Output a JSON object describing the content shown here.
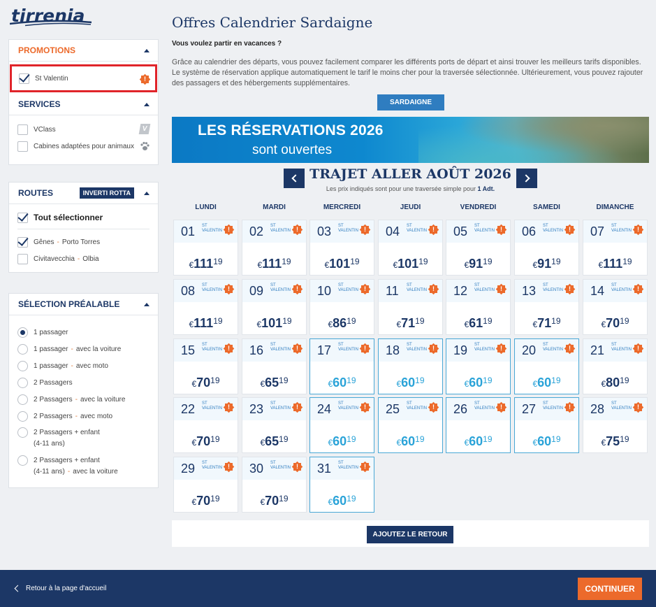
{
  "brand": {
    "logo_text": "tirrenia"
  },
  "sidebar": {
    "promotions": {
      "title": "PROMOTIONS",
      "items": [
        {
          "label": "St Valentin",
          "checked": true
        }
      ]
    },
    "services": {
      "title": "SERVICES",
      "items": [
        {
          "label": "VClass",
          "checked": false
        },
        {
          "label": "Cabines adaptées pour animaux",
          "checked": false
        }
      ]
    },
    "routes": {
      "title": "ROUTES",
      "invert_label": "INVERTI ROTTA",
      "select_all_label": "Tout sélectionner",
      "items": [
        {
          "from": "Gênes",
          "to": "Porto Torres",
          "checked": true
        },
        {
          "from": "Civitavecchia",
          "to": "Olbia",
          "checked": false
        }
      ]
    },
    "preselection": {
      "title": "SÉLECTION PRÉALABLE",
      "options": [
        {
          "line1": "1 passager",
          "extra": "",
          "line2": "",
          "selected": true
        },
        {
          "line1": "1 passager",
          "extra": "avec la voiture",
          "line2": "",
          "selected": false
        },
        {
          "line1": "1 passager",
          "extra": "avec moto",
          "line2": "",
          "selected": false
        },
        {
          "line1": "2 Passagers",
          "extra": "",
          "line2": "",
          "selected": false
        },
        {
          "line1": "2 Passagers",
          "extra": "avec la voiture",
          "line2": "",
          "selected": false
        },
        {
          "line1": "2 Passagers",
          "extra": "avec moto",
          "line2": "",
          "selected": false
        },
        {
          "line1": "2 Passagers + enfant",
          "extra": "",
          "line2": "(4-11 ans)",
          "selected": false
        },
        {
          "line1": "2 Passagers + enfant",
          "extra": "",
          "line2": "(4-11 ans)",
          "line2_extra": "avec la voiture",
          "selected": false
        }
      ]
    }
  },
  "main": {
    "title": "Offres Calendrier Sardaigne",
    "subtitle": "Vous voulez partir en vacances ?",
    "intro": "Grâce au calendrier des départs, vous pouvez facilement comparer les différents ports de départ et ainsi trouver les meilleurs tarifs disponibles. Le système de réservation applique automatiquement le tarif le moins cher pour la traversée sélectionnée. Ultérieurement, vous pouvez rajouter des passagers et des hébergements supplémentaires.",
    "destination_button": "SARDAIGNE",
    "banner": {
      "line1": "LES RÉSERVATIONS 2026",
      "line2": "sont ouvertes"
    },
    "trip_title": "TRAJET ALLER AOÛT 2026",
    "trip_note_prefix": "Les prix indiqués sont pour une traversée simple pour ",
    "trip_note_bold": "1 Adt.",
    "weekdays": [
      "LUNDI",
      "MARDI",
      "MERCREDI",
      "JEUDI",
      "VENDREDI",
      "SAMEDI",
      "DIMANCHE"
    ],
    "promo_tag": "ST VALENTIN",
    "currency": "€",
    "days": [
      {
        "day": "01",
        "int": "111",
        "dec": "19",
        "hl": false
      },
      {
        "day": "02",
        "int": "111",
        "dec": "19",
        "hl": false
      },
      {
        "day": "03",
        "int": "101",
        "dec": "19",
        "hl": false
      },
      {
        "day": "04",
        "int": "101",
        "dec": "19",
        "hl": false
      },
      {
        "day": "05",
        "int": "91",
        "dec": "19",
        "hl": false
      },
      {
        "day": "06",
        "int": "91",
        "dec": "19",
        "hl": false
      },
      {
        "day": "07",
        "int": "111",
        "dec": "19",
        "hl": false
      },
      {
        "day": "08",
        "int": "111",
        "dec": "19",
        "hl": false
      },
      {
        "day": "09",
        "int": "101",
        "dec": "19",
        "hl": false
      },
      {
        "day": "10",
        "int": "86",
        "dec": "19",
        "hl": false
      },
      {
        "day": "11",
        "int": "71",
        "dec": "19",
        "hl": false
      },
      {
        "day": "12",
        "int": "61",
        "dec": "19",
        "hl": false
      },
      {
        "day": "13",
        "int": "71",
        "dec": "19",
        "hl": false
      },
      {
        "day": "14",
        "int": "70",
        "dec": "19",
        "hl": false
      },
      {
        "day": "15",
        "int": "70",
        "dec": "19",
        "hl": false
      },
      {
        "day": "16",
        "int": "65",
        "dec": "19",
        "hl": false
      },
      {
        "day": "17",
        "int": "60",
        "dec": "19",
        "hl": true
      },
      {
        "day": "18",
        "int": "60",
        "dec": "19",
        "hl": true
      },
      {
        "day": "19",
        "int": "60",
        "dec": "19",
        "hl": true
      },
      {
        "day": "20",
        "int": "60",
        "dec": "19",
        "hl": true
      },
      {
        "day": "21",
        "int": "80",
        "dec": "19",
        "hl": false
      },
      {
        "day": "22",
        "int": "70",
        "dec": "19",
        "hl": false
      },
      {
        "day": "23",
        "int": "65",
        "dec": "19",
        "hl": false
      },
      {
        "day": "24",
        "int": "60",
        "dec": "19",
        "hl": true
      },
      {
        "day": "25",
        "int": "60",
        "dec": "19",
        "hl": true
      },
      {
        "day": "26",
        "int": "60",
        "dec": "19",
        "hl": true
      },
      {
        "day": "27",
        "int": "60",
        "dec": "19",
        "hl": true
      },
      {
        "day": "28",
        "int": "75",
        "dec": "19",
        "hl": false
      },
      {
        "day": "29",
        "int": "70",
        "dec": "19",
        "hl": false
      },
      {
        "day": "30",
        "int": "70",
        "dec": "19",
        "hl": false
      },
      {
        "day": "31",
        "int": "60",
        "dec": "19",
        "hl": true
      }
    ],
    "add_return_button": "AJOUTEZ LE RETOUR"
  },
  "footer": {
    "back_label": "Retour à la page d'accueil",
    "continue_label": "CONTINUER"
  },
  "colors": {
    "navy": "#1c3766",
    "orange": "#ec6a2b",
    "accent_blue": "#2aa3d8",
    "button_blue": "#2f7dc0"
  }
}
